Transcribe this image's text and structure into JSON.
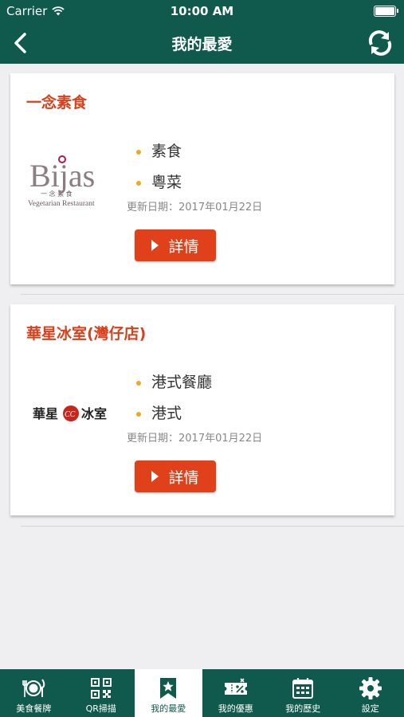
{
  "status_bar": {
    "carrier": "Carrier",
    "time": "10:00 AM"
  },
  "navbar": {
    "title": "我的最愛"
  },
  "restaurants": [
    {
      "name": "一念素食",
      "logo_text": "Bijas",
      "logo_sub": "一 念 素 食",
      "logo_caption": "Vegetarian Restaurant",
      "tags": [
        "素食",
        "粵菜"
      ],
      "updated": "更新日期：2017年01月22日",
      "button_label": "詳情"
    },
    {
      "name": "華星冰室(灣仔店)",
      "logo_text": "華星",
      "logo_mark": "CC",
      "logo_text2": "冰室",
      "tags": [
        "港式餐廳",
        "港式"
      ],
      "updated": "更新日期：2017年01月22日",
      "button_label": "詳情"
    }
  ],
  "tabbar": {
    "tabs": [
      {
        "label": "美食餐牌",
        "icon": "dining-plate-icon"
      },
      {
        "label": "QR掃描",
        "icon": "qr-code-icon"
      },
      {
        "label": "我的最愛",
        "icon": "bookmark-star-icon",
        "active": true
      },
      {
        "label": "我的優惠",
        "icon": "coupon-icon"
      },
      {
        "label": "我的歷史",
        "icon": "calendar-icon"
      },
      {
        "label": "設定",
        "icon": "gear-icon"
      }
    ]
  },
  "colors": {
    "primary": "#0f5a4c",
    "accent": "#e0401a",
    "title": "#d9411d",
    "bullet": "#f0a81c"
  }
}
